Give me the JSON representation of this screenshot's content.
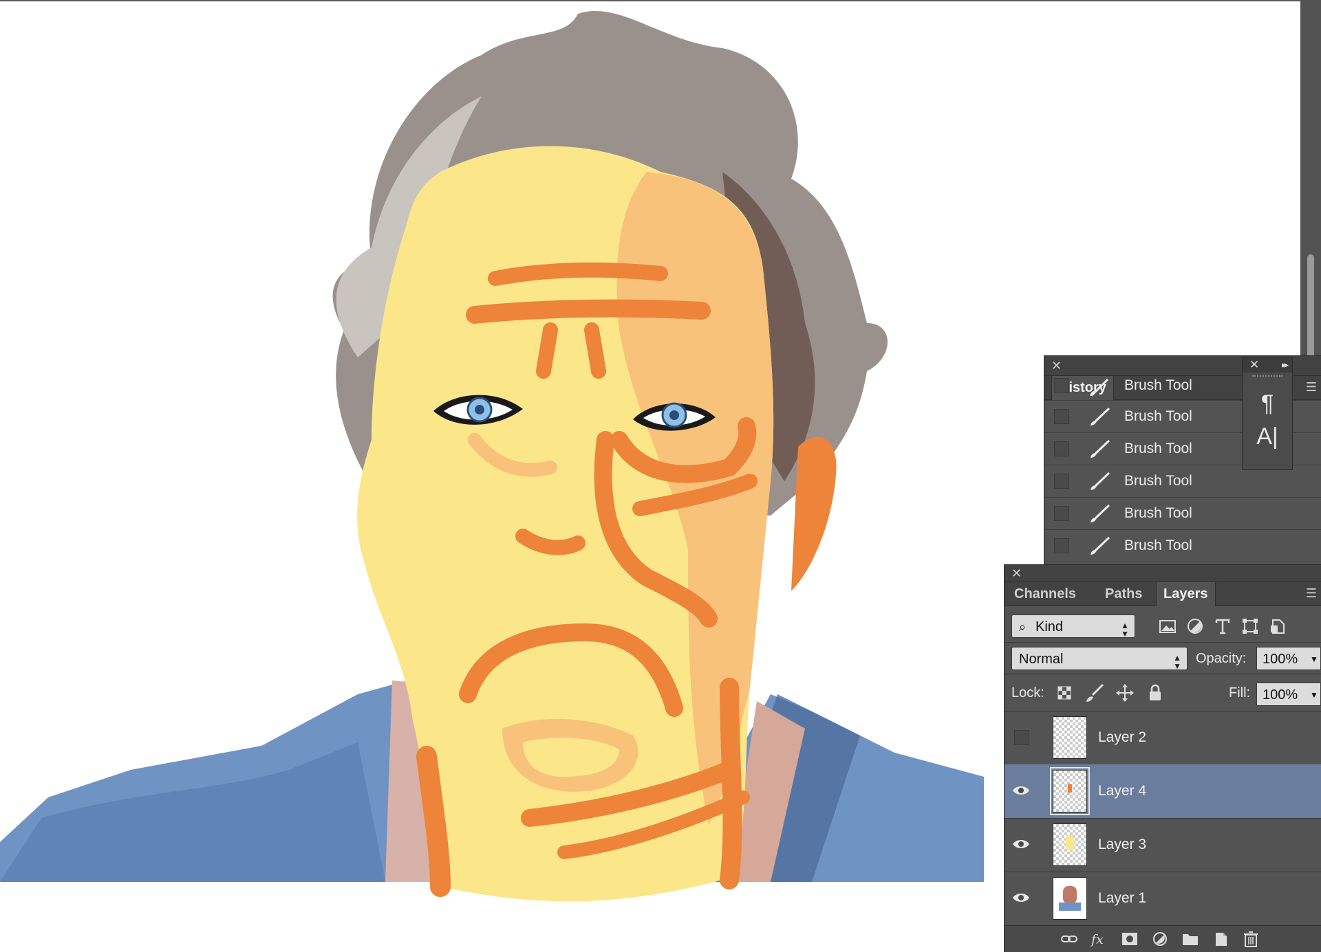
{
  "history": {
    "tab": "History",
    "items": [
      "Brush Tool",
      "Brush Tool",
      "Brush Tool",
      "Brush Tool",
      "Brush Tool",
      "Brush Tool"
    ]
  },
  "character_panel": {
    "paragraph_glyph": "¶",
    "character_glyph": "A|"
  },
  "layers_panel": {
    "tabs": [
      "Channels",
      "Paths",
      "Layers"
    ],
    "active_tab": "Layers",
    "filter_kind": "Kind",
    "blend_mode": "Normal",
    "opacity_label": "Opacity:",
    "opacity_value": "100%",
    "lock_label": "Lock:",
    "fill_label": "Fill:",
    "fill_value": "100%",
    "layers": [
      {
        "name": "Layer 2",
        "visible": false,
        "selected": false
      },
      {
        "name": "Layer 4",
        "visible": true,
        "selected": true
      },
      {
        "name": "Layer 3",
        "visible": true,
        "selected": false
      },
      {
        "name": "Layer 1",
        "visible": true,
        "selected": false
      }
    ]
  },
  "colors": {
    "panel_bg": "#535353",
    "selected_layer": "#6a7d9c",
    "skin_light": "#fbe78a",
    "skin_mid": "#f8c27a",
    "skin_dark": "#ed8439",
    "iris": "#8fc0e6",
    "jacket": "#6f93c2"
  }
}
